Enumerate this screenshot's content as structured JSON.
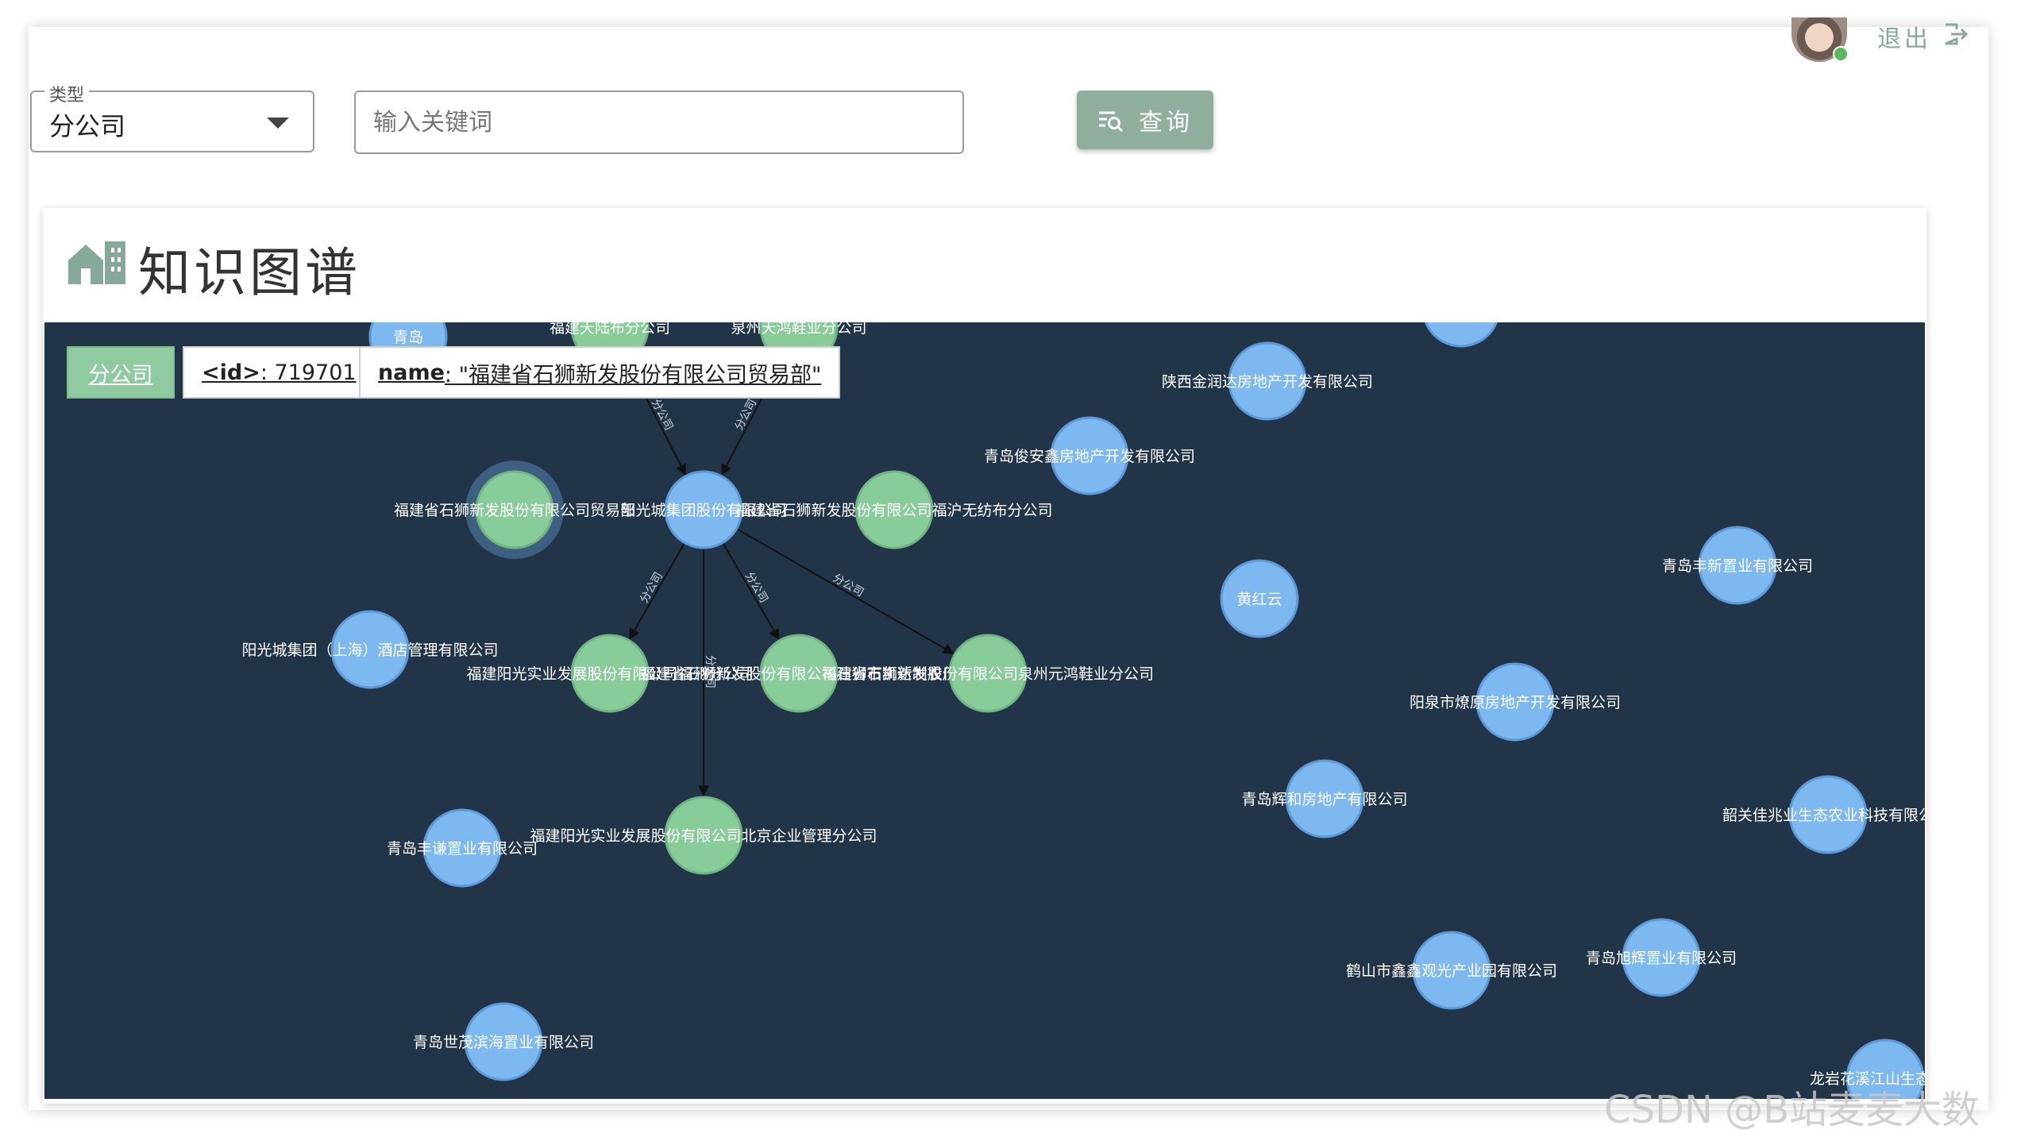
{
  "header": {
    "logout_label": "退出"
  },
  "search": {
    "type_legend": "类型",
    "type_value": "分公司",
    "keyword_placeholder": "输入关键词",
    "query_label": "查询"
  },
  "card": {
    "title": "知识图谱"
  },
  "selected": {
    "type": "分公司",
    "id_key": "<id>",
    "id_value": ": 719701",
    "name_key": "name",
    "name_value": ": \"福建省石狮新发股份有限公司贸易部\""
  },
  "colors": {
    "graph_bg": "#213448",
    "node_company": "#7db8f0",
    "node_branch": "#88cc99",
    "accent": "#8fae9e"
  },
  "graph": {
    "edge_label": "分公司",
    "nodes": [
      {
        "id": "n_center",
        "label": "阳光城集团股份有限公司",
        "kind": "company"
      },
      {
        "id": "n_b1",
        "label": "福建省石狮新发股份有限公司贸易部",
        "kind": "branch",
        "selected": true
      },
      {
        "id": "n_b2",
        "label": "福建省石狮新发股份有限公司福沪无纺布分公司",
        "kind": "branch"
      },
      {
        "id": "n_b3",
        "label": "福建阳光实业发展股份有限公司福州分公司",
        "kind": "branch"
      },
      {
        "id": "n_b4",
        "label": "福建省石狮新发股份有限公司石狮市凯达制衣厂",
        "kind": "branch"
      },
      {
        "id": "n_b5",
        "label": "福建省石狮新发股份有限公司泉州元鸿鞋业分公司",
        "kind": "branch"
      },
      {
        "id": "n_b6",
        "label": "福建阳光实业发展股份有限公司北京企业管理分公司",
        "kind": "branch"
      },
      {
        "id": "n_t1",
        "label": "福建天陆布分公司",
        "kind": "branch"
      },
      {
        "id": "n_t2",
        "label": "泉州天鸿鞋业分公司",
        "kind": "branch"
      },
      {
        "id": "n_t0",
        "label": "青岛",
        "kind": "company"
      },
      {
        "id": "n_c1",
        "label": "陕西金润达房地产开发有限公司",
        "kind": "company"
      },
      {
        "id": "n_c2",
        "label": "青岛俊安鑫房地产开发有限公司",
        "kind": "company"
      },
      {
        "id": "n_c3",
        "label": "青岛丰新置业有限公司",
        "kind": "company"
      },
      {
        "id": "n_c4",
        "label": "黄红云",
        "kind": "company"
      },
      {
        "id": "n_c5",
        "label": "阳光城集团（上海）酒店管理有限公司",
        "kind": "company"
      },
      {
        "id": "n_c6",
        "label": "阳泉市燎原房地产开发有限公司",
        "kind": "company"
      },
      {
        "id": "n_c7",
        "label": "青岛辉和房地产有限公司",
        "kind": "company"
      },
      {
        "id": "n_c8",
        "label": "韶关佳兆业生态农业科技有限公",
        "kind": "company"
      },
      {
        "id": "n_c9",
        "label": "青岛丰谦置业有限公司",
        "kind": "company"
      },
      {
        "id": "n_c10",
        "label": "鹤山市鑫鑫观光产业园有限公司",
        "kind": "company"
      },
      {
        "id": "n_c11",
        "label": "青岛旭辉置业有限公司",
        "kind": "company"
      },
      {
        "id": "n_c12",
        "label": "青岛世茂滨海置业有限公司",
        "kind": "company"
      },
      {
        "id": "n_c13",
        "label": "龙岩花溪江山生态旅游",
        "kind": "company"
      },
      {
        "id": "n_c14",
        "label": "",
        "kind": "company"
      }
    ]
  },
  "watermark": "CSDN @B站麦麦大数据"
}
